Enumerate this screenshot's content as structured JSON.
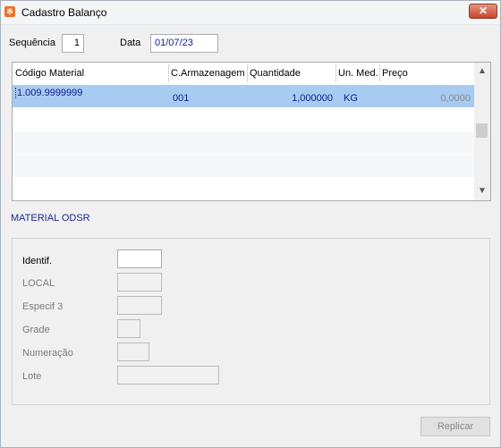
{
  "window": {
    "title": "Cadastro Balanço",
    "close_label": "✕",
    "app_icon": "app-logo-icon"
  },
  "header": {
    "sequencia_label": "Sequência",
    "sequencia_value": "1",
    "data_label": "Data",
    "data_value": "01/07/23"
  },
  "grid": {
    "columns": [
      "Código Material",
      "C.Armazenagem",
      "Quantidade",
      "Un. Med.",
      "Preço"
    ],
    "rows": [
      {
        "codigo": "1.009.9999999",
        "armazenagem": "001",
        "quantidade": "1,000000",
        "unidade": "KG",
        "preco": "0,0000"
      }
    ],
    "scroll_up": "▲",
    "scroll_down": "▼"
  },
  "material": {
    "title": "MATERIAL ODSR"
  },
  "form": {
    "identif_label": "Identif.",
    "identif_value": "",
    "local_label": "LOCAL",
    "local_value": "",
    "especif_label": "Especif 3",
    "especif_value": "",
    "grade_label": "Grade",
    "grade_value": "",
    "numeracao_label": "Numeração",
    "numeracao_value": "",
    "lote_label": "Lote",
    "lote_value": ""
  },
  "actions": {
    "replicar_label": "Replicar"
  },
  "colors": {
    "selection": "#a8cbf1",
    "accent_text": "#1a2a8c",
    "close": "#c7452c"
  }
}
